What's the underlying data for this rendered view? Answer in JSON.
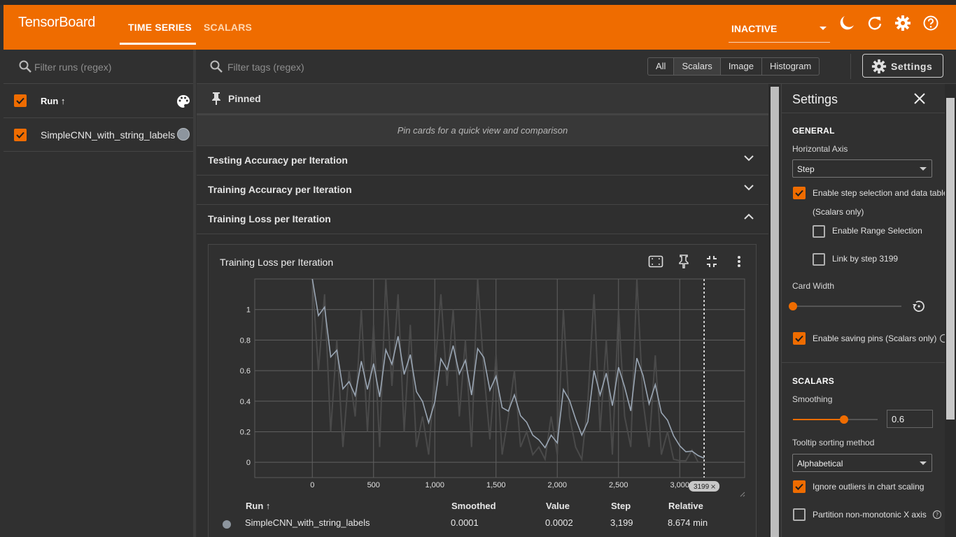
{
  "app": {
    "title": "TensorBoard"
  },
  "nav": {
    "tabs": [
      {
        "label": "TIME SERIES",
        "active": true
      },
      {
        "label": "SCALARS",
        "active": false
      }
    ],
    "plugin_select": "INACTIVE",
    "icons": [
      "dark-mode-icon",
      "reload-icon",
      "settings-icon",
      "help-icon"
    ]
  },
  "runs": {
    "filter_placeholder": "Filter runs (regex)",
    "column_label": "Run ↑",
    "items": [
      {
        "name": "SimpleCNN_with_string_labels",
        "checked": true,
        "color": "#8d959e"
      }
    ]
  },
  "toolbar": {
    "filter_placeholder": "Filter tags (regex)",
    "type_filters": [
      "All",
      "Scalars",
      "Image",
      "Histogram"
    ],
    "active_type_filter": "Scalars",
    "settings_label": "Settings"
  },
  "pinned": {
    "label": "Pinned",
    "empty_text": "Pin cards for a quick view and comparison"
  },
  "groups": [
    {
      "label": "Testing Accuracy per Iteration",
      "expanded": false
    },
    {
      "label": "Training Accuracy per Iteration",
      "expanded": false
    },
    {
      "label": "Training Loss per Iteration",
      "expanded": true
    }
  ],
  "card": {
    "title": "Training Loss per Iteration",
    "step_marker_label": "3199",
    "legend": {
      "headers": {
        "run": "Run ↑",
        "smoothed": "Smoothed",
        "value": "Value",
        "step": "Step",
        "relative": "Relative"
      },
      "row": {
        "run": "SimpleCNN_with_string_labels",
        "smoothed": "0.0001",
        "value": "0.0002",
        "step": "3,199",
        "relative": "8.674 min"
      }
    }
  },
  "chart_data": {
    "type": "line",
    "title": "Training Loss per Iteration",
    "xlabel": "",
    "ylabel": "",
    "xlim": [
      -470,
      3530
    ],
    "ylim": [
      -0.1,
      1.2
    ],
    "x_ticks": [
      "0",
      "500",
      "1,000",
      "1,500",
      "2,000",
      "2,500",
      "3,000"
    ],
    "y_ticks": [
      "0",
      "0.2",
      "0.4",
      "0.6",
      "0.8",
      "1"
    ],
    "grid": true,
    "selected_step": 3199,
    "series": [
      {
        "name": "SimpleCNN_with_string_labels",
        "color": "#9aa6b4",
        "x": [
          0,
          50,
          100,
          150,
          200,
          250,
          300,
          350,
          400,
          450,
          500,
          550,
          600,
          650,
          700,
          750,
          800,
          850,
          900,
          950,
          1000,
          1050,
          1100,
          1150,
          1200,
          1250,
          1300,
          1350,
          1400,
          1450,
          1500,
          1550,
          1600,
          1650,
          1700,
          1750,
          1800,
          1850,
          1900,
          1950,
          2000,
          2050,
          2100,
          2150,
          2200,
          2250,
          2300,
          2350,
          2400,
          2450,
          2500,
          2550,
          2600,
          2650,
          2700,
          2750,
          2800,
          2850,
          2900,
          2950,
          3000,
          3050,
          3100,
          3150,
          3199
        ],
        "values": [
          1.2,
          0.6,
          1.1,
          0.2,
          0.8,
          0.1,
          0.6,
          0.3,
          1.0,
          0.2,
          0.9,
          0.1,
          1.2,
          0.5,
          1.1,
          0.2,
          0.9,
          0.1,
          0.3,
          0.05,
          0.6,
          1.1,
          0.5,
          1.0,
          0.3,
          0.8,
          0.1,
          1.2,
          0.6,
          0.15,
          0.7,
          0.05,
          0.3,
          0.6,
          0.1,
          0.2,
          0.05,
          0.1,
          0.02,
          0.3,
          0.05,
          1.0,
          0.3,
          0.1,
          0.02,
          0.4,
          1.1,
          0.2,
          0.8,
          0.05,
          1.0,
          0.3,
          0.1,
          1.2,
          0.4,
          0.1,
          0.7,
          0.05,
          0.2,
          0.02,
          0.01,
          0.01,
          0.08,
          0.001,
          0.0002
        ]
      }
    ]
  },
  "settings_panel": {
    "title": "Settings",
    "general": {
      "heading": "GENERAL",
      "horizontal_axis_label": "Horizontal Axis",
      "horizontal_axis_value": "Step",
      "step_selection_label": "Enable step selection and data table",
      "step_selection_note": "(Scalars only)",
      "step_selection_checked": true,
      "range_selection_label": "Enable Range Selection",
      "range_selection_checked": false,
      "link_by_step_label": "Link by step 3199",
      "link_by_step_checked": false,
      "card_width_label": "Card Width",
      "card_width": 0,
      "saving_pins_label": "Enable saving pins (Scalars only)",
      "saving_pins_checked": true
    },
    "scalars": {
      "heading": "SCALARS",
      "smoothing_label": "Smoothing",
      "smoothing_value": "0.6",
      "tooltip_sort_label": "Tooltip sorting method",
      "tooltip_sort_value": "Alphabetical",
      "ignore_outliers_label": "Ignore outliers in chart scaling",
      "ignore_outliers_checked": true,
      "partition_label": "Partition non-monotonic X axis",
      "partition_checked": false
    }
  }
}
